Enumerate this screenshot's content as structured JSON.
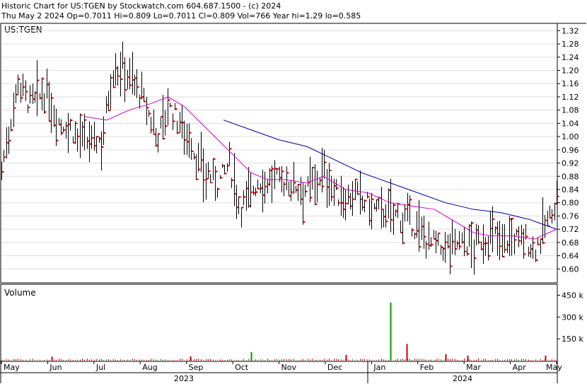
{
  "header": {
    "line1": "Historic Chart for US:TGEN by Stockwatch.com 604.687.1500 - (c) 2024",
    "line2": "Thu May  2 2024  Op=0.7011  Hi=0.809  Lo=0.7011  Cl=0.809  Vol=766  Year hi=1.29  lo=0.585"
  },
  "colors": {
    "up_bar": "#000000",
    "close_tick": "#cc0000",
    "ma_short": "#cc00cc",
    "ma_long": "#000099",
    "vol_down": "#cc0000",
    "vol_up": "#009900",
    "grid": "#dddddd"
  },
  "chart_data": [
    {
      "type": "ohlc",
      "symbol_label": "US:TGEN",
      "y_ticks": [
        "1.32",
        "1.28",
        "1.24",
        "1.20",
        "1.16",
        "1.12",
        "1.08",
        "1.04",
        "1.00",
        "0.96",
        "0.92",
        "0.88",
        "0.84",
        "0.80",
        "0.76",
        "0.72",
        "0.68",
        "0.64",
        "0.60"
      ],
      "ylim": [
        0.56,
        1.34
      ],
      "x_months": [
        "May",
        "Jun",
        "Jul",
        "Aug",
        "Sep",
        "Oct",
        "Nov",
        "Dec",
        "Jan",
        "Feb",
        "Mar",
        "Apr",
        "May"
      ],
      "x_years": [
        "2023",
        "2024"
      ],
      "price_path": [
        {
          "t": 0.0,
          "p": 0.9
        },
        {
          "t": 0.03,
          "p": 1.17
        },
        {
          "t": 0.05,
          "p": 1.1
        },
        {
          "t": 0.08,
          "p": 1.13
        },
        {
          "t": 0.1,
          "p": 1.05
        },
        {
          "t": 0.12,
          "p": 1.03
        },
        {
          "t": 0.15,
          "p": 0.98
        },
        {
          "t": 0.18,
          "p": 0.99
        },
        {
          "t": 0.2,
          "p": 1.2
        },
        {
          "t": 0.22,
          "p": 1.21
        },
        {
          "t": 0.25,
          "p": 1.13
        },
        {
          "t": 0.28,
          "p": 1.0
        },
        {
          "t": 0.3,
          "p": 1.09
        },
        {
          "t": 0.33,
          "p": 1.02
        },
        {
          "t": 0.36,
          "p": 0.9
        },
        {
          "t": 0.39,
          "p": 0.86
        },
        {
          "t": 0.41,
          "p": 0.92
        },
        {
          "t": 0.43,
          "p": 0.79
        },
        {
          "t": 0.46,
          "p": 0.86
        },
        {
          "t": 0.49,
          "p": 0.87
        },
        {
          "t": 0.52,
          "p": 0.86
        },
        {
          "t": 0.55,
          "p": 0.84
        },
        {
          "t": 0.58,
          "p": 0.89
        },
        {
          "t": 0.61,
          "p": 0.81
        },
        {
          "t": 0.64,
          "p": 0.82
        },
        {
          "t": 0.67,
          "p": 0.78
        },
        {
          "t": 0.7,
          "p": 0.77
        },
        {
          "t": 0.73,
          "p": 0.75
        },
        {
          "t": 0.76,
          "p": 0.7
        },
        {
          "t": 0.79,
          "p": 0.66
        },
        {
          "t": 0.82,
          "p": 0.68
        },
        {
          "t": 0.85,
          "p": 0.67
        },
        {
          "t": 0.88,
          "p": 0.7
        },
        {
          "t": 0.91,
          "p": 0.69
        },
        {
          "t": 0.94,
          "p": 0.69
        },
        {
          "t": 0.96,
          "p": 0.66
        },
        {
          "t": 0.98,
          "p": 0.73
        },
        {
          "t": 1.0,
          "p": 0.81
        }
      ],
      "ma_short_path": [
        {
          "t": 0.15,
          "p": 1.06
        },
        {
          "t": 0.19,
          "p": 1.05
        },
        {
          "t": 0.23,
          "p": 1.08
        },
        {
          "t": 0.27,
          "p": 1.1
        },
        {
          "t": 0.3,
          "p": 1.12
        },
        {
          "t": 0.33,
          "p": 1.09
        },
        {
          "t": 0.36,
          "p": 1.04
        },
        {
          "t": 0.39,
          "p": 0.99
        },
        {
          "t": 0.42,
          "p": 0.94
        },
        {
          "t": 0.45,
          "p": 0.89
        },
        {
          "t": 0.48,
          "p": 0.87
        },
        {
          "t": 0.51,
          "p": 0.87
        },
        {
          "t": 0.55,
          "p": 0.86
        },
        {
          "t": 0.58,
          "p": 0.88
        },
        {
          "t": 0.62,
          "p": 0.84
        },
        {
          "t": 0.66,
          "p": 0.83
        },
        {
          "t": 0.7,
          "p": 0.8
        },
        {
          "t": 0.74,
          "p": 0.79
        },
        {
          "t": 0.78,
          "p": 0.78
        },
        {
          "t": 0.81,
          "p": 0.75
        },
        {
          "t": 0.85,
          "p": 0.71
        },
        {
          "t": 0.88,
          "p": 0.7
        },
        {
          "t": 0.92,
          "p": 0.7
        },
        {
          "t": 0.96,
          "p": 0.69
        },
        {
          "t": 1.0,
          "p": 0.72
        }
      ],
      "ma_long_path": [
        {
          "t": 0.4,
          "p": 1.05
        },
        {
          "t": 0.45,
          "p": 1.02
        },
        {
          "t": 0.5,
          "p": 0.99
        },
        {
          "t": 0.55,
          "p": 0.97
        },
        {
          "t": 0.6,
          "p": 0.93
        },
        {
          "t": 0.65,
          "p": 0.89
        },
        {
          "t": 0.7,
          "p": 0.86
        },
        {
          "t": 0.75,
          "p": 0.83
        },
        {
          "t": 0.8,
          "p": 0.8
        },
        {
          "t": 0.85,
          "p": 0.78
        },
        {
          "t": 0.9,
          "p": 0.77
        },
        {
          "t": 0.95,
          "p": 0.75
        },
        {
          "t": 1.0,
          "p": 0.72
        }
      ]
    },
    {
      "type": "bar",
      "title": "Volume",
      "y_ticks": [
        "450 k",
        "300 k",
        "150 k"
      ],
      "ylim": [
        0,
        520
      ],
      "spikes": [
        {
          "t": 0.7,
          "v": 400,
          "up": true
        },
        {
          "t": 0.73,
          "v": 115,
          "up": false
        },
        {
          "t": 0.45,
          "v": 60,
          "up": true
        },
        {
          "t": 0.62,
          "v": 40,
          "up": false
        },
        {
          "t": 0.84,
          "v": 35,
          "up": false
        },
        {
          "t": 0.98,
          "v": 35,
          "up": false
        },
        {
          "t": 0.09,
          "v": 28,
          "up": false
        },
        {
          "t": 0.34,
          "v": 30,
          "up": false
        },
        {
          "t": 0.8,
          "v": 45,
          "up": false
        }
      ]
    }
  ]
}
